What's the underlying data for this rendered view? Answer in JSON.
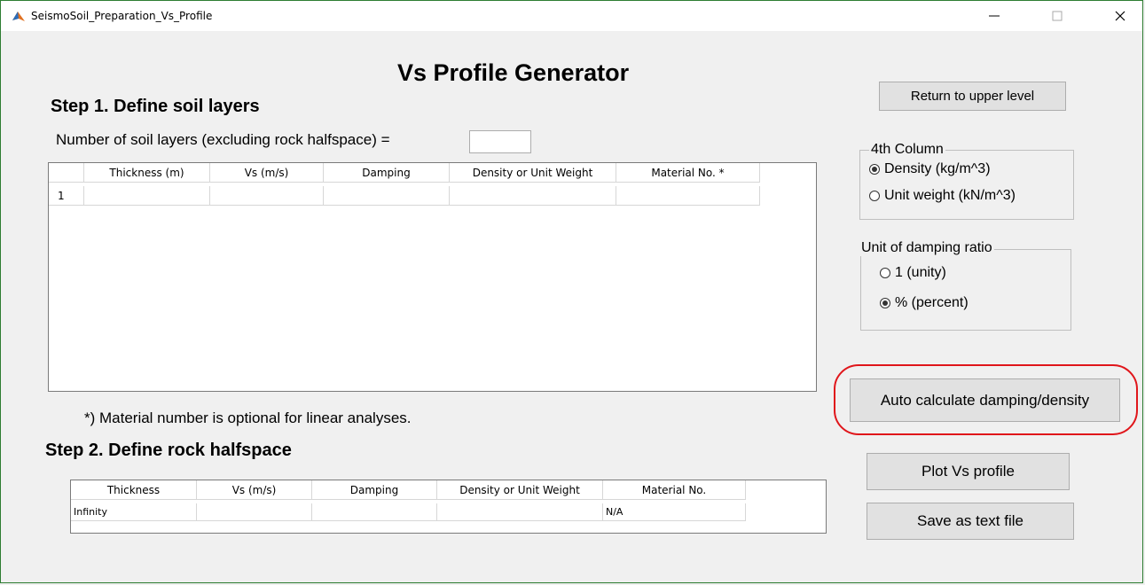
{
  "window": {
    "title": "SeismoSoil_Preparation_Vs_Profile",
    "controls": {
      "minimize": "—",
      "maximize": "☐",
      "close": "✕"
    }
  },
  "main": {
    "title": "Vs Profile Generator",
    "step1": {
      "heading": "Step 1. Define soil layers",
      "layers_label": "Number of soil layers (excluding rock halfspace) =",
      "layers_value": "",
      "table": {
        "columns": [
          "Thickness (m)",
          "Vs (m/s)",
          "Damping",
          "Density or Unit Weight",
          "Material No. *"
        ],
        "rows": [
          {
            "index": "1",
            "cells": [
              "",
              "",
              "",
              "",
              ""
            ]
          }
        ]
      },
      "note": "*) Material number is optional for linear analyses."
    },
    "step2": {
      "heading": "Step 2. Define rock halfspace",
      "table": {
        "columns": [
          "Thickness",
          "Vs (m/s)",
          "Damping",
          "Density or Unit Weight",
          "Material No."
        ],
        "rows": [
          {
            "cells": [
              "Infinity",
              "",
              "",
              "",
              "N/A"
            ]
          }
        ]
      }
    }
  },
  "side": {
    "return_button": "Return to upper level",
    "fourth_column": {
      "title": "4th Column",
      "options": [
        {
          "label": "Density (kg/m^3)",
          "selected": true
        },
        {
          "label": "Unit weight (kN/m^3)",
          "selected": false
        }
      ]
    },
    "damping_unit": {
      "title": "Unit of damping ratio",
      "options": [
        {
          "label": "1 (unity)",
          "selected": false
        },
        {
          "label": "% (percent)",
          "selected": true
        }
      ]
    },
    "auto_button": "Auto calculate damping/density",
    "plot_button": "Plot Vs profile",
    "save_button": "Save as text file"
  },
  "colors": {
    "highlight": "#e0161b",
    "window_border": "#2e7d32"
  }
}
